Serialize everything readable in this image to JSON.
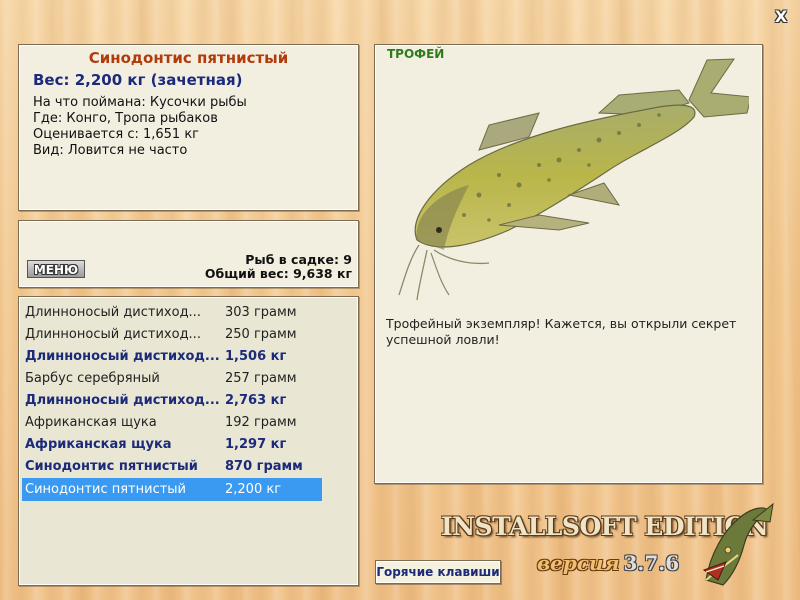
{
  "catch": {
    "title": "Синодонтис пятнистый",
    "weight": "Вес: 2,200 кг (зачетная)",
    "bait": "На что поймана: Кусочки рыбы",
    "place": "Где: Конго, Тропа рыбаков",
    "value": "Оценивается с: 1,651 кг",
    "rarity": "Вид: Ловится не часто"
  },
  "status": {
    "menu_label": "МЕНЮ",
    "fish_count": "Рыб в садке: 9",
    "total_weight": "Общий вес: 9,638 кг"
  },
  "fish_list": [
    {
      "name": "Длинноносый дистиход...",
      "weight": "303 грамм"
    },
    {
      "name": "Длинноносый дистиход...",
      "weight": "250 грамм"
    },
    {
      "name": "Длинноносый дистиход...",
      "weight": "1,506 кг"
    },
    {
      "name": "Барбус серебряный",
      "weight": "257 грамм"
    },
    {
      "name": "Длинноносый дистиход...",
      "weight": "2,763 кг"
    },
    {
      "name": "Африканская щука",
      "weight": "192 грамм"
    },
    {
      "name": "Африканская щука",
      "weight": "1,297 кг"
    },
    {
      "name": "Синодонтис пятнистый",
      "weight": "870 грамм"
    },
    {
      "name": "Синодонтис пятнистый",
      "weight": "2,200 кг"
    }
  ],
  "trophy": {
    "label": "ТРОФЕЙ",
    "description": "Трофейный экземпляр! Кажется, вы открыли секрет успешной ловли!"
  },
  "brand": {
    "title": "INSTALLSOFT EDITION",
    "version_word": "версия",
    "version_number": "3.7.6"
  },
  "hotkeys_label": "Горячие клавиши",
  "close_label": "X",
  "colors": {
    "title_red": "#b23b0c",
    "accent_navy": "#1b2a7a",
    "trophy_green": "#2e7b1e",
    "selection_blue": "#3a9af2",
    "panel_bg": "#f2efe1"
  }
}
